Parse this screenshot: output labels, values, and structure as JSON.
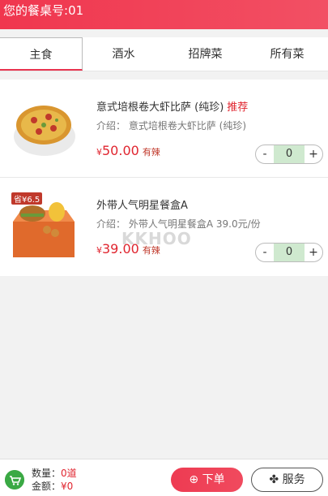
{
  "header": {
    "table_label": "您的餐桌号",
    "table_number": ":01"
  },
  "tabs": [
    {
      "label": "主食"
    },
    {
      "label": "酒水"
    },
    {
      "label": "招牌菜"
    },
    {
      "label": "所有菜"
    }
  ],
  "items": [
    {
      "name": "意式培根卷大虾比萨 (纯珍)",
      "recommend": "推荐",
      "desc_label": "介绍：",
      "desc": "意式培根卷大虾比萨 (纯珍)",
      "currency": "¥",
      "price": "50.00",
      "tag": "有辣",
      "qty": "0",
      "minus": "-",
      "plus": "+"
    },
    {
      "name": "外带人气明星餐盒A",
      "desc_label": "介绍：",
      "desc": "外带人气明星餐盒A 39.0元/份",
      "currency": "¥",
      "price": "39.00",
      "tag": "有辣",
      "qty": "0",
      "minus": "-",
      "plus": "+",
      "badge": "省¥6.5"
    }
  ],
  "footer": {
    "qty_label": "数量：",
    "qty_value": "0道",
    "amount_label": "金额：",
    "amount_value": "¥0",
    "order_label": "下单",
    "service_label": "服务"
  },
  "watermark": "KKHOO"
}
